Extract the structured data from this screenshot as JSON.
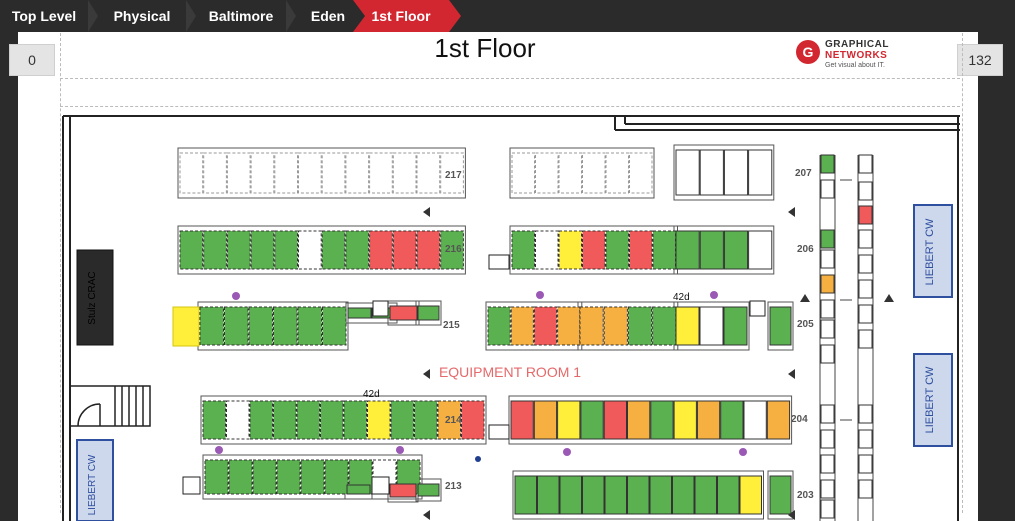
{
  "breadcrumb": {
    "items": [
      {
        "label": "Top Level"
      },
      {
        "label": "Physical"
      },
      {
        "label": "Baltimore"
      },
      {
        "label": "Eden"
      },
      {
        "label": "1st Floor"
      }
    ]
  },
  "pager": {
    "left": "0",
    "right": "132"
  },
  "page_title": "1st Floor",
  "logo": {
    "line1": "GRAPHICAL",
    "line2": "NETWORKS",
    "tagline": "Get visual about IT."
  },
  "room_label": "EQUIPMENT ROOM 1",
  "crac": {
    "label": "Stulz CRAC"
  },
  "liebert": [
    {
      "label": "LIEBERT CW"
    },
    {
      "label": "LIEBERT CW"
    },
    {
      "label": "LIEBERT CW"
    }
  ],
  "row_numbers": [
    "217",
    "216",
    "215",
    "214",
    "213",
    "207",
    "206",
    "205",
    "204",
    "203"
  ],
  "badges": [
    "42d",
    "42d"
  ],
  "colors": {
    "green": "#5bb14f",
    "red": "#f15a5a",
    "yellow": "#ffef3a",
    "orange": "#f6b042",
    "accent": "#d22730"
  }
}
